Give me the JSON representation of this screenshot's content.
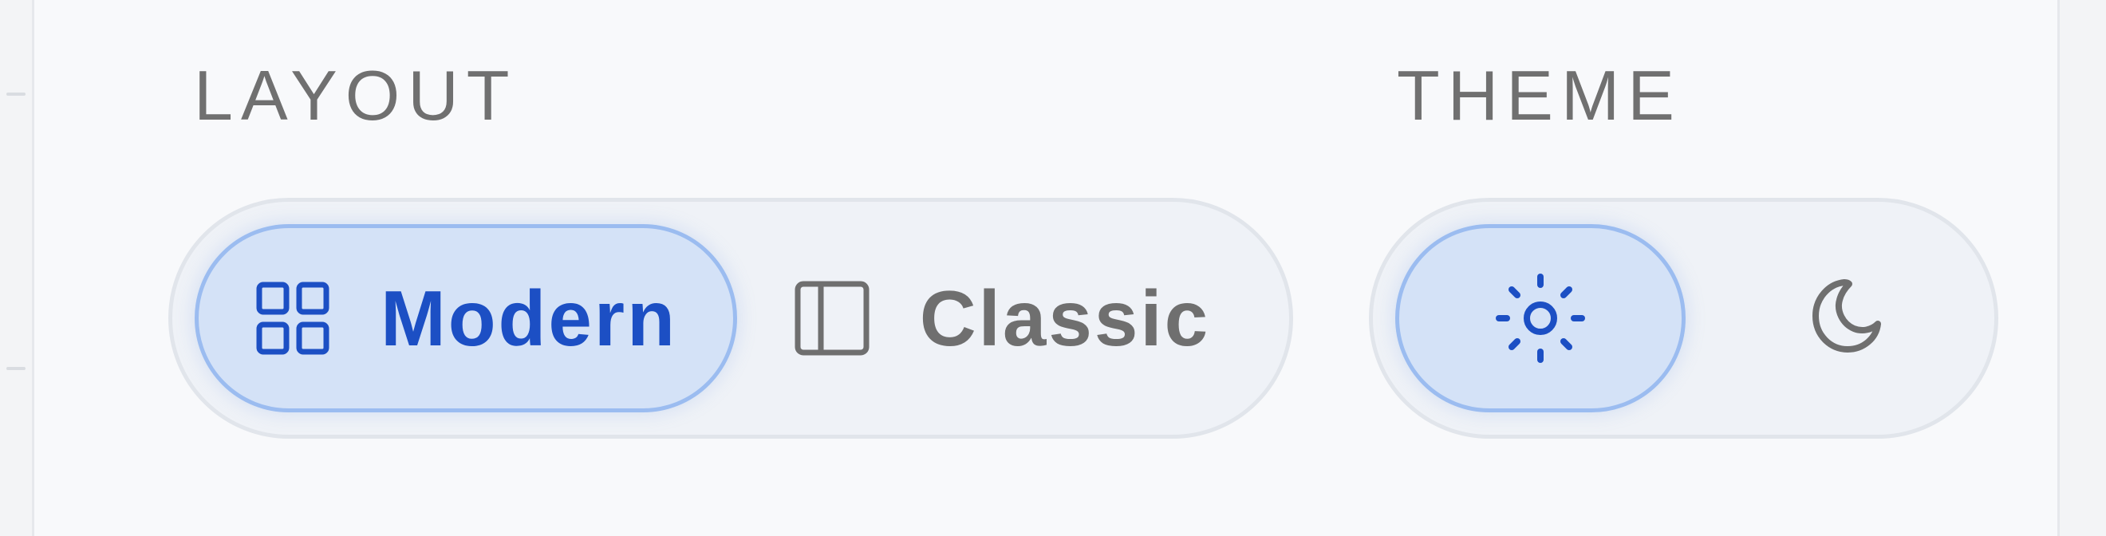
{
  "layout": {
    "heading": "LAYOUT",
    "options": [
      {
        "label": "Modern",
        "icon": "grid-icon",
        "selected": true
      },
      {
        "label": "Classic",
        "icon": "sidebar-layout-icon",
        "selected": false
      }
    ]
  },
  "theme": {
    "heading": "THEME",
    "options": [
      {
        "name": "light",
        "icon": "sun-icon",
        "selected": true
      },
      {
        "name": "dark",
        "icon": "moon-icon",
        "selected": false
      }
    ]
  },
  "colors": {
    "active_text": "#1c4fc4",
    "active_bg": "#d4e2f7",
    "active_border": "#9bbcf0",
    "inactive_text": "#6f6f6f"
  }
}
